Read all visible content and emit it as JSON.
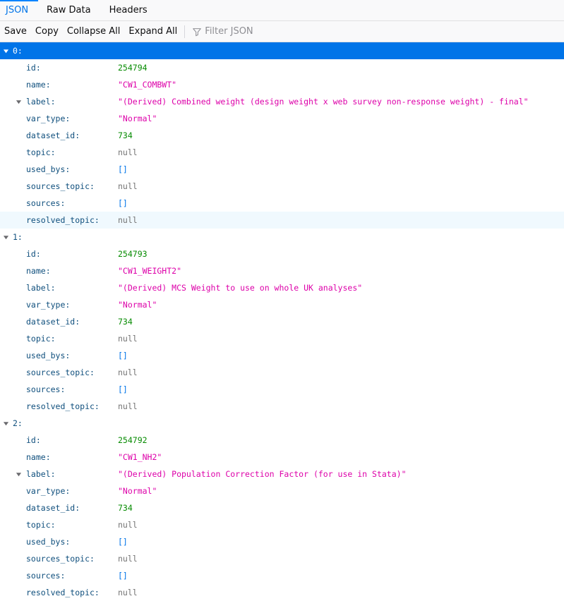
{
  "tabs": [
    {
      "label": "JSON",
      "selected": true
    },
    {
      "label": "Raw Data",
      "selected": false
    },
    {
      "label": "Headers",
      "selected": false
    }
  ],
  "toolbar": {
    "save": "Save",
    "copy": "Copy",
    "collapse_all": "Collapse All",
    "expand_all": "Expand All",
    "filter_placeholder": "Filter JSON",
    "filter_icon": "filter-icon"
  },
  "colors": {
    "accent": "#0074e8",
    "number": "#058b00",
    "string": "#dd00a9",
    "null": "#737373",
    "array": "#0074e8",
    "key": "#0f4f7d"
  },
  "records": [
    {
      "index": "0:",
      "selected": true,
      "fields": [
        {
          "key": "id:",
          "value": "254794",
          "type": "num"
        },
        {
          "key": "name:",
          "value": "\"CW1_COMBWT\"",
          "type": "str"
        },
        {
          "key": "label:",
          "value": "\"(Derived) Combined weight (design weight x web survey non-response weight) - final\"",
          "type": "str",
          "expandable": true
        },
        {
          "key": "var_type:",
          "value": "\"Normal\"",
          "type": "str"
        },
        {
          "key": "dataset_id:",
          "value": "734",
          "type": "num"
        },
        {
          "key": "topic:",
          "value": "null",
          "type": "null"
        },
        {
          "key": "used_bys:",
          "value": "[]",
          "type": "arr"
        },
        {
          "key": "sources_topic:",
          "value": "null",
          "type": "null"
        },
        {
          "key": "sources:",
          "value": "[]",
          "type": "arr"
        },
        {
          "key": "resolved_topic:",
          "value": "null",
          "type": "null",
          "hover": true
        }
      ]
    },
    {
      "index": "1:",
      "selected": false,
      "fields": [
        {
          "key": "id:",
          "value": "254793",
          "type": "num"
        },
        {
          "key": "name:",
          "value": "\"CW1_WEIGHT2\"",
          "type": "str"
        },
        {
          "key": "label:",
          "value": "\"(Derived) MCS Weight to use on whole UK analyses\"",
          "type": "str"
        },
        {
          "key": "var_type:",
          "value": "\"Normal\"",
          "type": "str"
        },
        {
          "key": "dataset_id:",
          "value": "734",
          "type": "num"
        },
        {
          "key": "topic:",
          "value": "null",
          "type": "null"
        },
        {
          "key": "used_bys:",
          "value": "[]",
          "type": "arr"
        },
        {
          "key": "sources_topic:",
          "value": "null",
          "type": "null"
        },
        {
          "key": "sources:",
          "value": "[]",
          "type": "arr"
        },
        {
          "key": "resolved_topic:",
          "value": "null",
          "type": "null"
        }
      ]
    },
    {
      "index": "2:",
      "selected": false,
      "fields": [
        {
          "key": "id:",
          "value": "254792",
          "type": "num"
        },
        {
          "key": "name:",
          "value": "\"CW1_NH2\"",
          "type": "str"
        },
        {
          "key": "label:",
          "value": "\"(Derived) Population Correction Factor (for use in Stata)\"",
          "type": "str",
          "expandable": true
        },
        {
          "key": "var_type:",
          "value": "\"Normal\"",
          "type": "str"
        },
        {
          "key": "dataset_id:",
          "value": "734",
          "type": "num"
        },
        {
          "key": "topic:",
          "value": "null",
          "type": "null"
        },
        {
          "key": "used_bys:",
          "value": "[]",
          "type": "arr"
        },
        {
          "key": "sources_topic:",
          "value": "null",
          "type": "null"
        },
        {
          "key": "sources:",
          "value": "[]",
          "type": "arr"
        },
        {
          "key": "resolved_topic:",
          "value": "null",
          "type": "null"
        }
      ]
    }
  ]
}
